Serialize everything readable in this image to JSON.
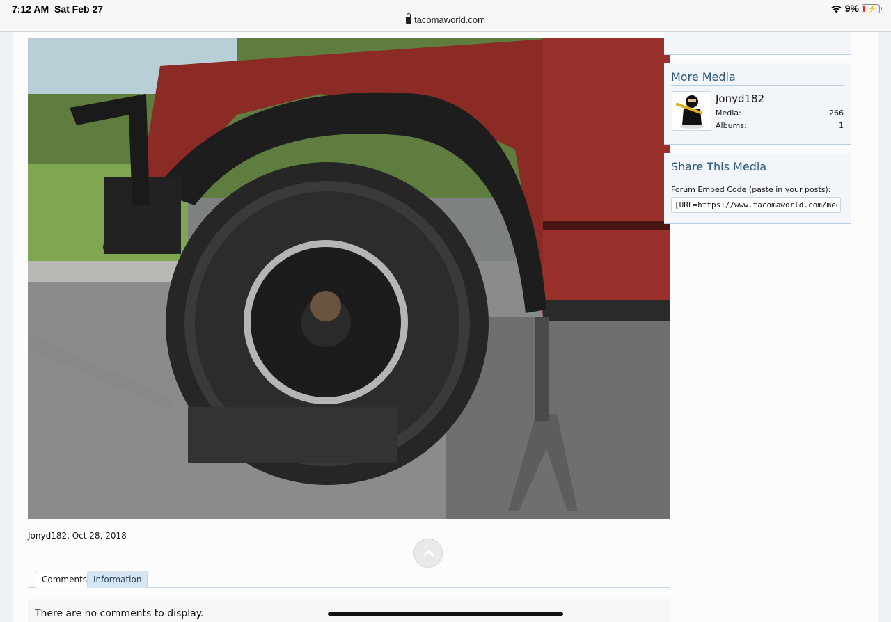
{
  "status_bar": {
    "time": "7:12 AM",
    "date": "Sat Feb 27",
    "url": "tacomaworld.com",
    "battery": "9%",
    "battery_level": 0.09,
    "icons": [
      "lock-icon",
      "wifi-icon",
      "battery-icon"
    ]
  },
  "media": {
    "image_alt": "Red Toyota Tacoma with large off-road tire on jack stand",
    "author": "Jonyd182",
    "date": "Oct 28, 2018",
    "meta": "Jonyd182, Oct 28, 2018"
  },
  "tabs": [
    {
      "label": "Comments",
      "active": true
    },
    {
      "label": "Information",
      "active": false
    }
  ],
  "comments": {
    "empty_text": "There are no comments to display."
  },
  "sidebar": {
    "more_media": {
      "heading": "More Media",
      "uploader": "Jonyd182",
      "media_label": "Media:",
      "media_count": "266",
      "albums_label": "Albums:",
      "albums_count": "1"
    },
    "share": {
      "heading": "Share This Media",
      "embed_label": "Forum Embed Code (paste in your posts):",
      "embed_value": "[URL=https://www.tacomaworld.com/media"
    }
  },
  "colors": {
    "accent": "#2d5578",
    "border": "#b8cee2",
    "tab_inactive_bg": "#d7e5f2"
  }
}
